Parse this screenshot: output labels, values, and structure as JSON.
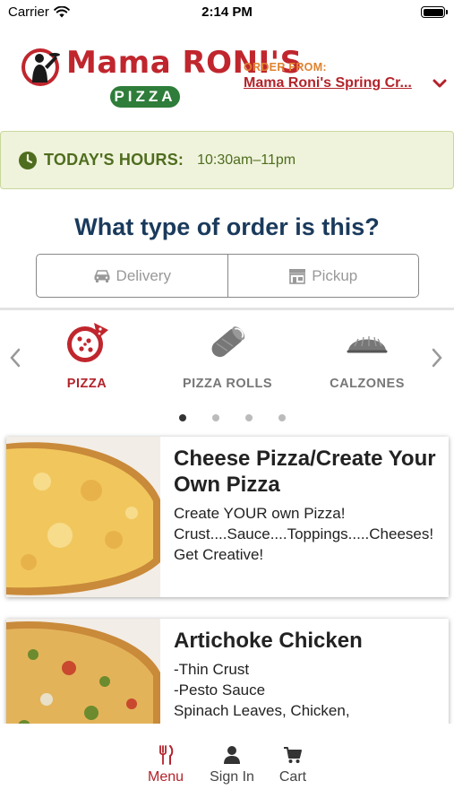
{
  "status_bar": {
    "carrier": "Carrier",
    "time": "2:14 PM"
  },
  "header": {
    "brand_name": "Mama RONI'S",
    "brand_sub": "PIZZA",
    "order_from_label": "ORDER FROM:",
    "order_from_location": "Mama Roni's Spring Cr..."
  },
  "hours": {
    "label": "TODAY'S HOURS:",
    "value": "10:30am–11pm"
  },
  "order_type": {
    "question": "What type of order is this?",
    "options": [
      {
        "label": "Delivery"
      },
      {
        "label": "Pickup"
      }
    ]
  },
  "categories": {
    "items": [
      {
        "label": "PIZZA",
        "active": true
      },
      {
        "label": "PIZZA ROLLS",
        "active": false
      },
      {
        "label": "CALZONES",
        "active": false
      }
    ],
    "page_count": 4,
    "current_page": 1
  },
  "menu": {
    "items": [
      {
        "title": "Cheese Pizza/Create Your Own Pizza",
        "description": "Create YOUR own Pizza!\nCrust....Sauce....Toppings.....Cheeses!\nGet Creative!"
      },
      {
        "title": "Artichoke Chicken",
        "description": "-Thin Crust\n-Pesto Sauce\nSpinach Leaves, Chicken,"
      }
    ]
  },
  "tabbar": {
    "items": [
      {
        "label": "Menu",
        "icon": "fork-knife-icon",
        "active": true
      },
      {
        "label": "Sign In",
        "icon": "person-icon",
        "active": false
      },
      {
        "label": "Cart",
        "icon": "cart-icon",
        "active": false
      }
    ]
  },
  "colors": {
    "brand_red": "#c0262d",
    "brand_green": "#2e7d3a",
    "order_from_orange": "#e0822e",
    "heading_navy": "#1a3a5c",
    "hours_bg": "#eff3dc",
    "hours_text": "#4f6d1e"
  }
}
